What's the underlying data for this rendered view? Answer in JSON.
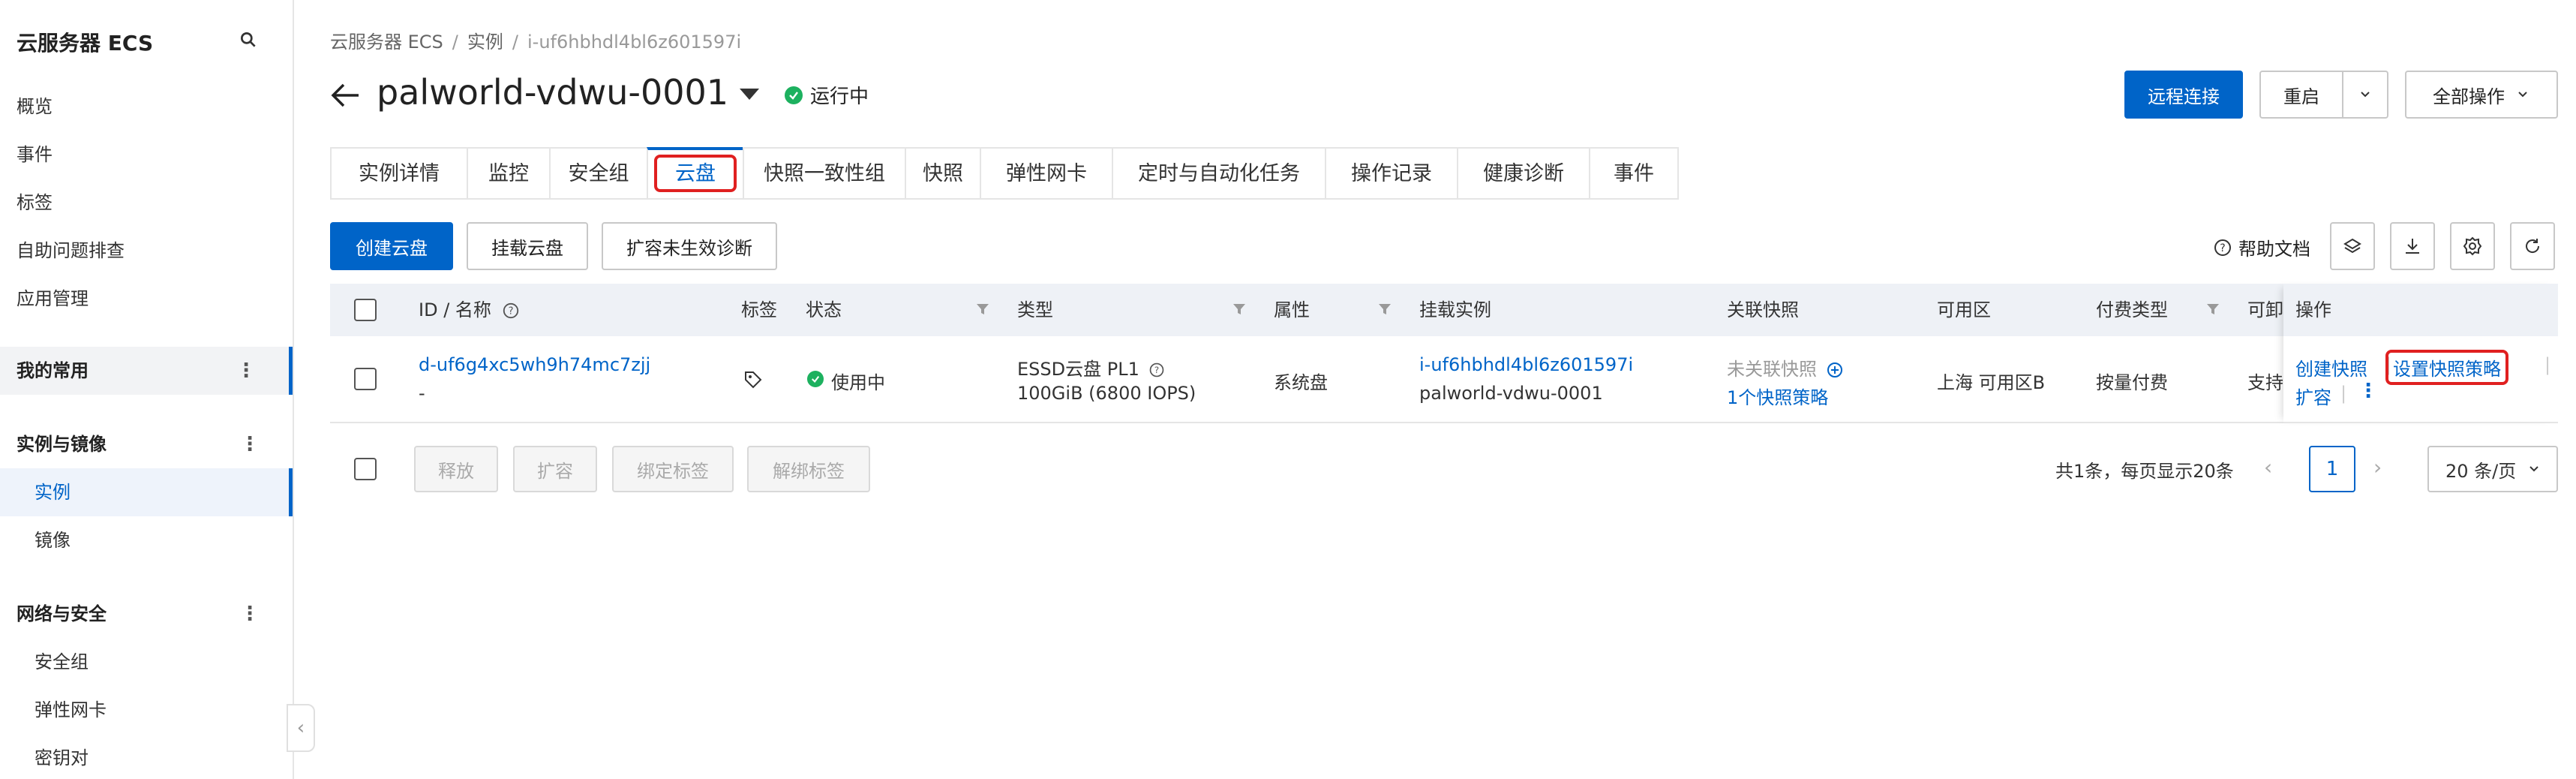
{
  "sidebar": {
    "title": "云服务器 ECS",
    "items": {
      "overview": "概览",
      "events": "事件",
      "tags": "标签",
      "troubleshoot": "自助问题排查",
      "app_mgmt": "应用管理",
      "favorites": "我的常用",
      "instances_images": "实例与镜像",
      "instances": "实例",
      "images": "镜像",
      "network_security": "网络与安全",
      "security_group": "安全组",
      "eni": "弹性网卡",
      "keypair": "密钥对"
    },
    "collapse_glyph": "‹"
  },
  "breadcrumb": [
    "云服务器 ECS",
    "实例",
    "i-uf6hbhdl4bl6z601597i"
  ],
  "breadcrumb_sep": "/",
  "header": {
    "title": "palworld-vdwu-0001",
    "status": "运行中",
    "remote_connect": "远程连接",
    "restart": "重启",
    "all_actions": "全部操作"
  },
  "tabs": [
    "实例详情",
    "监控",
    "安全组",
    "云盘",
    "快照一致性组",
    "快照",
    "弹性网卡",
    "定时与自动化任务",
    "操作记录",
    "健康诊断",
    "事件"
  ],
  "actions": {
    "create_disk": "创建云盘",
    "attach_disk": "挂载云盘",
    "resize_diag": "扩容未生效诊断",
    "help_doc": "帮助文档"
  },
  "table": {
    "headers": {
      "id_name": "ID / 名称",
      "tags": "标签",
      "status": "状态",
      "type": "类型",
      "attribute": "属性",
      "attached_instance": "挂载实例",
      "snapshot": "关联快照",
      "zone": "可用区",
      "billing": "付费类型",
      "release": "可卸载",
      "ops": "操作"
    },
    "row": {
      "id": "d-uf6g4xc5wh9h74mc7zjj",
      "name": "-",
      "status": "使用中",
      "type": "ESSD云盘 PL1",
      "spec": "100GiB (6800 IOPS)",
      "attribute": "系统盘",
      "instance_id": "i-uf6hbhdl4bl6z601597i",
      "instance_name": "palworld-vdwu-0001",
      "snapshot_status": "未关联快照",
      "snapshot_policy": "1个快照策略",
      "zone": "上海 可用区B",
      "billing": "按量付费",
      "release": "支持",
      "op_create_snapshot": "创建快照",
      "op_set_policy": "设置快照策略",
      "op_resize": "扩容"
    }
  },
  "bottom": {
    "release": "释放",
    "resize": "扩容",
    "bind_tag": "绑定标签",
    "unbind_tag": "解绑标签",
    "summary": "共1条，每页显示20条",
    "page": "1",
    "page_size": "20 条/页",
    "prev": "‹",
    "next": "›"
  },
  "colors": {
    "primary": "#0064c8",
    "success": "#1db15f",
    "highlight": "#e02020"
  }
}
